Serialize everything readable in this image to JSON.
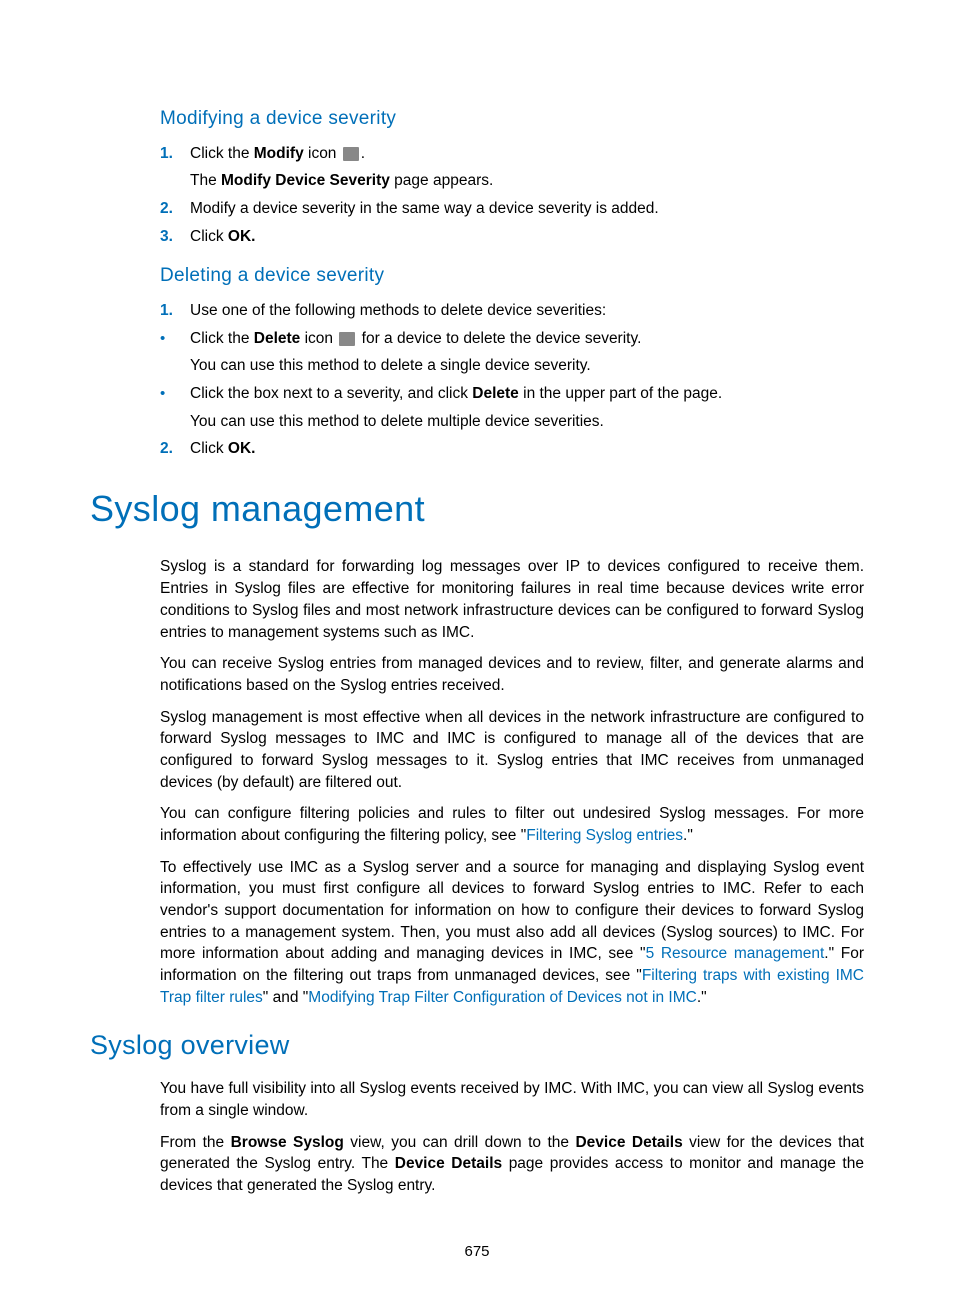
{
  "sections": {
    "modify": {
      "heading": "Modifying a device severity",
      "step1_pre": "Click the ",
      "step1_bold": "Modify",
      "step1_post": " icon ",
      "step1_end": ".",
      "step1_sub_pre": "The ",
      "step1_sub_bold": "Modify Device Severity",
      "step1_sub_post": " page appears.",
      "step2": "Modify a device severity in the same way a device severity is added.",
      "step3_pre": "Click ",
      "step3_bold": "OK."
    },
    "delete": {
      "heading": "Deleting a device severity",
      "step1": "Use one of the following methods to delete device severities:",
      "b1_pre": "Click the ",
      "b1_bold": "Delete",
      "b1_mid": " icon ",
      "b1_post": " for a device to delete the device severity.",
      "b1_sub": "You can use this method to delete a single device severity.",
      "b2_pre": "Click the box next to a severity, and click ",
      "b2_bold": "Delete",
      "b2_post": " in the upper part of the page.",
      "b2_sub": "You can use this method to delete multiple device severities.",
      "step2_pre": "Click ",
      "step2_bold": "OK."
    },
    "syslog_mgmt": {
      "heading": "Syslog management",
      "p1": "Syslog is a standard for forwarding log messages over IP to devices configured to receive them. Entries in Syslog files are effective for monitoring failures in real time because devices write error conditions to Syslog files and most network infrastructure devices can be configured to forward Syslog entries to management systems such as IMC.",
      "p2": "You can receive Syslog entries from managed devices and to review, filter, and generate alarms and notifications based on the Syslog entries received.",
      "p3": "Syslog management is most effective when all devices in the network infrastructure are configured to forward Syslog messages to IMC and IMC is configured to manage all of the devices that are configured to forward Syslog messages to it. Syslog entries that IMC receives from unmanaged devices (by default) are filtered out.",
      "p4_pre": "You can configure filtering policies and rules to filter out undesired Syslog messages. For more information about configuring the filtering policy, see \"",
      "p4_link": "Filtering Syslog entries",
      "p4_post": ".\"",
      "p5_pre": "To effectively use IMC as a Syslog server and a source for managing and displaying Syslog event information, you must first configure all devices to forward Syslog entries to IMC. Refer to each vendor's support documentation for information on how to configure their devices to forward Syslog entries to a management system. Then, you must also add all devices (Syslog sources) to IMC. For more information about adding and managing devices in IMC, see \"",
      "p5_link1": "5 Resource management",
      "p5_mid1": ".\" For information on the filtering out traps from unmanaged devices, see \"",
      "p5_link2": "Filtering traps with existing IMC Trap filter rules",
      "p5_mid2": "\" and \"",
      "p5_link3": "Modifying Trap Filter Configuration of Devices not in IMC",
      "p5_post": ".\""
    },
    "syslog_overview": {
      "heading": "Syslog overview",
      "p1": "You have full visibility into all Syslog events received by IMC. With IMC, you can view all Syslog events from a single window.",
      "p2_pre": "From the ",
      "p2_b1": "Browse Syslog",
      "p2_mid1": " view, you can drill down to the ",
      "p2_b2": "Device Details",
      "p2_mid2": " view for the devices that generated the Syslog entry. The ",
      "p2_b3": "Device Details",
      "p2_post": " page provides access to monitor and manage the devices that generated the Syslog entry."
    }
  },
  "nums": {
    "n1": "1.",
    "n2": "2.",
    "n3": "3."
  },
  "page_number": "675"
}
